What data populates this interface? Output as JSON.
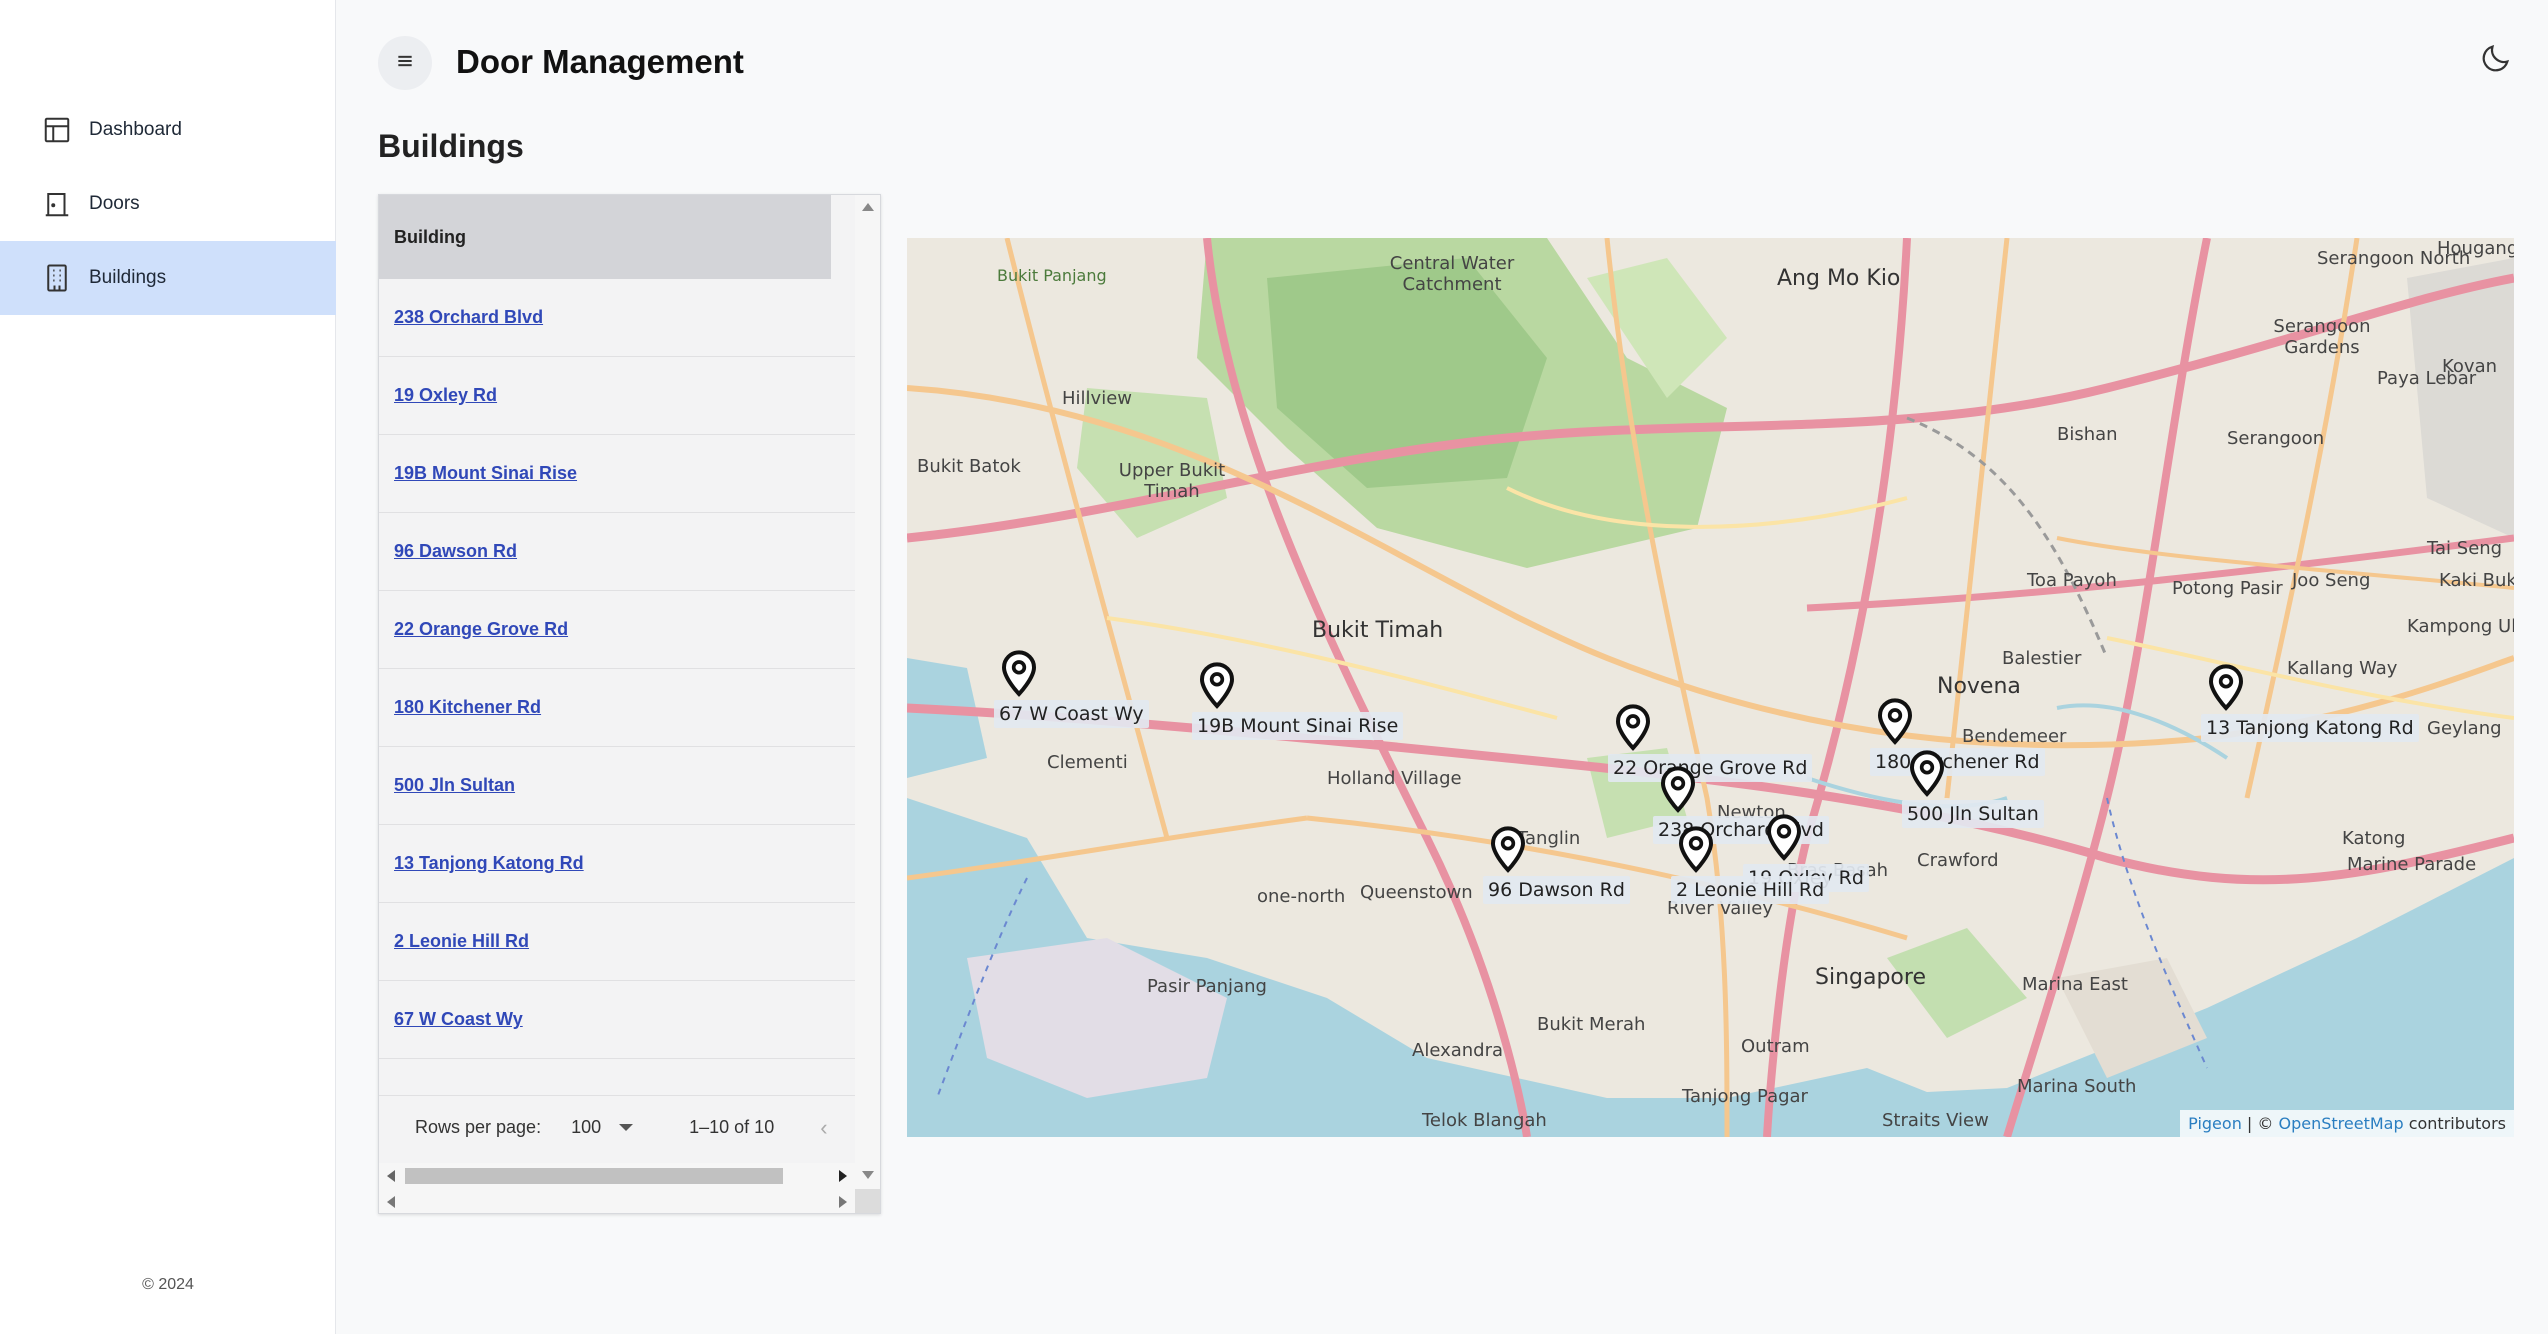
{
  "app": {
    "title": "Door Management",
    "copyright": "© 2024"
  },
  "sidebar": {
    "items": [
      {
        "label": "Dashboard",
        "icon": "dashboard-icon",
        "active": false
      },
      {
        "label": "Doors",
        "icon": "door-icon",
        "active": false
      },
      {
        "label": "Buildings",
        "icon": "building-icon",
        "active": true
      }
    ]
  },
  "page": {
    "title": "Buildings"
  },
  "table": {
    "column_header": "Building",
    "rows": [
      "238 Orchard Blvd",
      "19 Oxley Rd",
      "19B Mount Sinai Rise",
      "96 Dawson Rd",
      "22 Orange Grove Rd",
      "180 Kitchener Rd",
      "500 Jln Sultan",
      "13 Tanjong Katong Rd",
      "2 Leonie Hill Rd",
      "67 W Coast Wy"
    ],
    "pagination": {
      "rows_per_page_label": "Rows per page:",
      "rows_per_page_value": "100",
      "range": "1–10 of 10"
    }
  },
  "map": {
    "markers": [
      {
        "label": "67 W Coast Wy"
      },
      {
        "label": "19B Mount Sinai Rise"
      },
      {
        "label": "22 Orange Grove Rd"
      },
      {
        "label": "238 Orchard Blvd"
      },
      {
        "label": "19 Oxley Rd"
      },
      {
        "label": "2 Leonie Hill Rd"
      },
      {
        "label": "96 Dawson Rd"
      },
      {
        "label": "180 Kitchener Rd"
      },
      {
        "label": "500 Jln Sultan"
      },
      {
        "label": "13 Tanjong Katong Rd"
      }
    ],
    "place_labels": [
      "Serangoon North",
      "Hougang",
      "Central Water Catchment",
      "Ang Mo Kio",
      "Serangoon Gardens",
      "Kovan",
      "Paya Lebar",
      "Bukit Panjang",
      "Hillview",
      "Bishan",
      "Serangoon",
      "Bukit Batok",
      "Upper Bukit Timah",
      "Toa Payoh",
      "Potong Pasir",
      "Joo Seng",
      "Tai Seng",
      "Kaki Bukit",
      "Kampong Ubi",
      "Bukit Timah",
      "Novena",
      "Balestier",
      "Kallang Way",
      "Clementi",
      "Holland Village",
      "Bendemeer",
      "Geylang",
      "Tanglin",
      "Newton",
      "Crawford",
      "Katong",
      "Marine Parade",
      "one-north",
      "Queenstown",
      "River Valley",
      "Bras Basah",
      "Singapore",
      "Pasir Panjang",
      "Marina East",
      "Bukit Merah",
      "Alexandra",
      "Outram",
      "Tanjong Pagar",
      "Telok Blangah",
      "Straits View",
      "Marina South"
    ],
    "attribution": {
      "link1": "Pigeon",
      "sep": " | © ",
      "link2": "OpenStreetMap",
      "suffix": " contributors"
    }
  },
  "colors": {
    "accent": "#cfe0fb",
    "link": "#3048b8"
  }
}
